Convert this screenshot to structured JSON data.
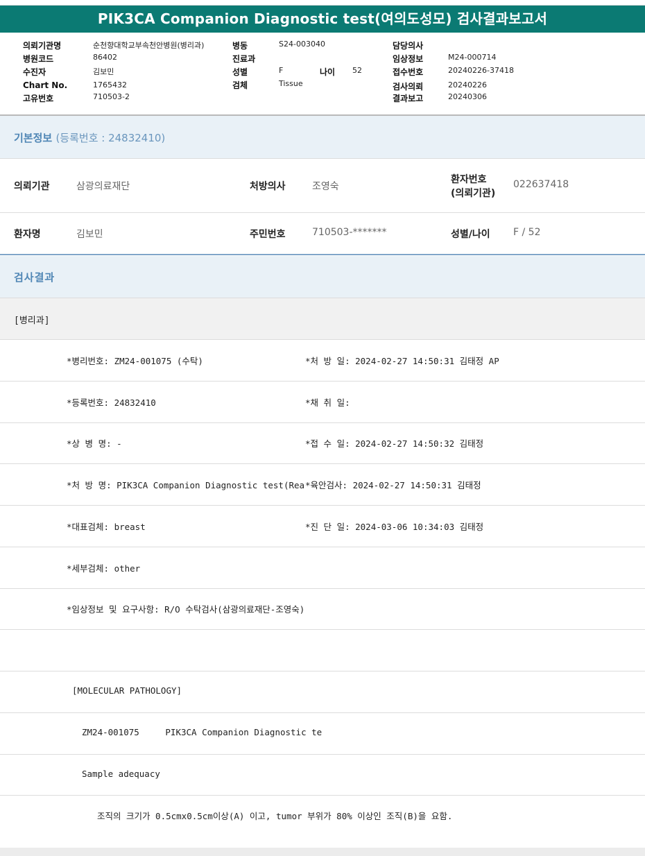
{
  "report_title": "PIK3CA Companion Diagnostic test(여의도성모) 검사결과보고서",
  "header": {
    "institution_label": "의뢰기관명",
    "institution_value": "순천향대학교부속천안병원(병리과)",
    "hospital_code_label": "병원코드",
    "hospital_code_value": "86402",
    "examinee_label": "수진자",
    "examinee_value": "김보민",
    "chart_no_label": "Chart No.",
    "chart_no_value": "1765432",
    "unique_no_label": "고유번호",
    "unique_no_value": "710503-2",
    "ward_label": "병동",
    "ward_value": "S24-003040",
    "department_label": "진료과",
    "department_value": "",
    "sex_label": "성별",
    "sex_value": "F",
    "age_label": "나이",
    "age_value": "52",
    "specimen_label": "검체",
    "specimen_value": "Tissue",
    "doctor_label": "담당의사",
    "doctor_value": "",
    "clinical_label": "임상정보",
    "clinical_value": "M24-000714",
    "receipt_label": "접수번호",
    "receipt_value": "20240226-37418",
    "request_label": "검사의뢰",
    "request_value": "20240226",
    "report_label": "결과보고",
    "report_value": "20240306"
  },
  "basic_info": {
    "title": "기본정보",
    "registration": "(등록번호 : 24832410)",
    "institution_label": "의뢰기관",
    "institution_value": "삼광의료재단",
    "prescriber_label": "처방의사",
    "prescriber_value": "조영숙",
    "patient_no_label_1": "환자번호",
    "patient_no_label_2": "(의뢰기관)",
    "patient_no_value": "022637418",
    "patient_name_label": "환자명",
    "patient_name_value": "김보민",
    "resident_no_label": "주민번호",
    "resident_no_value": "710503-*******",
    "sex_age_label": "성별/나이",
    "sex_age_value": "F / 52"
  },
  "results": {
    "title": "검사결과",
    "dept": "[병리과]",
    "left_lines": [
      "*병리번호: ZM24-001075 (수탁)",
      "*등록번호: 24832410",
      "*상 병 명: -",
      "*처 방 명: PIK3CA Companion Diagnostic test(Rea",
      "*대표검체: breast",
      "*세부검체: other",
      "*임상정보 및 요구사항: R/O 수탁검사(삼광의료재단-조영숙)"
    ],
    "right_lines": [
      "*처 방 일: 2024-02-27 14:50:31  김태정 AP",
      "*채 취 일:",
      "*접 수 일: 2024-02-27 14:50:32  김태정",
      "*육안검사: 2024-02-27 14:50:31  김태정",
      "*진 단 일: 2024-03-06 10:34:03  김태정"
    ],
    "molecular_header": "[MOLECULAR PATHOLOGY]",
    "molecular_case": "ZM24-001075     PIK3CA Companion Diagnostic te",
    "sample_adequacy": "Sample adequacy",
    "adequacy_note": "조직의 크기가 0.5cmx0.5cm이상(A) 이고, tumor 부위가 80% 이상인 조직(B)을 요함."
  }
}
